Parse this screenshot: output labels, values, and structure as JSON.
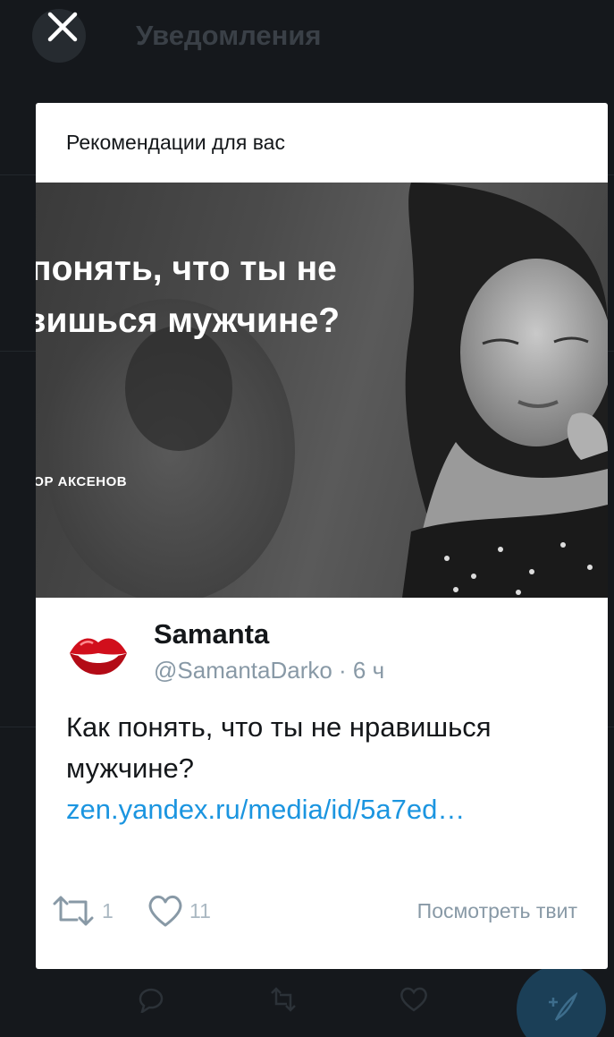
{
  "background": {
    "title": "Уведомления"
  },
  "modal": {
    "header": "Рекомендации для вас",
    "hero": {
      "title_line1": "ак понять, что ты не",
      "title_line2": "равишься мужчине?",
      "author": "ТОР АКСЕНОВ"
    },
    "tweet": {
      "name": "Samanta",
      "handle": "@SamantaDarko",
      "separator": " · ",
      "time": "6 ч",
      "text": "Как понять, что ты не нравишься мужчине? ",
      "link_text": "zen.yandex.ru/media/id/5a7ed…",
      "retweet_count": "1",
      "like_count": "11",
      "view_label": "Посмотреть твит"
    }
  },
  "icons": {
    "close": "close-icon",
    "retweet": "retweet-icon",
    "like": "heart-icon",
    "avatar": "lips-icon",
    "compose": "compose-icon"
  },
  "colors": {
    "link": "#1b95e0",
    "background": "#15181c",
    "muted": "#8899a6"
  }
}
